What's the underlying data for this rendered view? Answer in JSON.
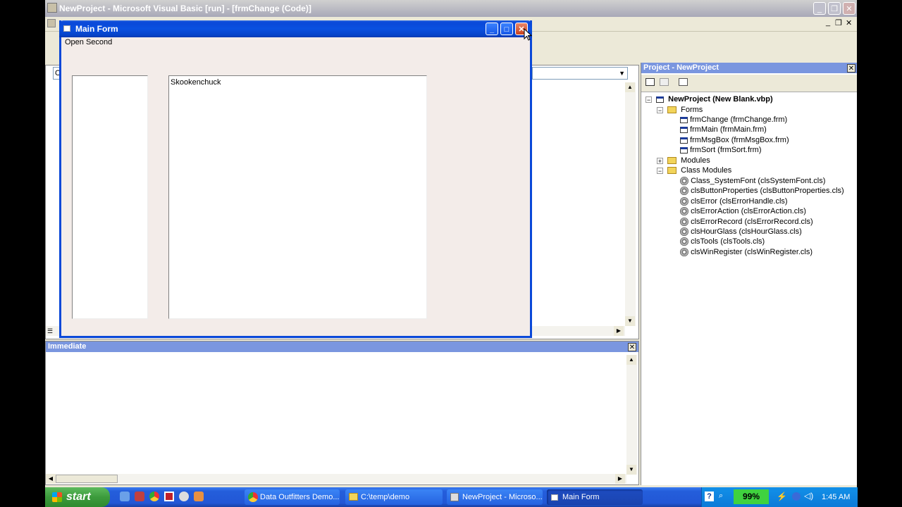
{
  "main_window": {
    "title": "NewProject - Microsoft Visual Basic [run] - [frmChange (Code)]"
  },
  "main_form": {
    "title": "Main Form",
    "menu": [
      "Open Second"
    ],
    "listbox_right_item": "Skookenchuck"
  },
  "code_pane": {
    "dropdown_left": "O"
  },
  "project_panel": {
    "title": "Project - NewProject",
    "root": "NewProject (New Blank.vbp)",
    "folders": {
      "forms": "Forms",
      "modules": "Modules",
      "class_modules": "Class Modules"
    },
    "forms": [
      "frmChange (frmChange.frm)",
      "frmMain (frmMain.frm)",
      "frmMsgBox (frmMsgBox.frm)",
      "frmSort (frmSort.frm)"
    ],
    "class_modules": [
      "Class_SystemFont (clsSystemFont.cls)",
      "clsButtonProperties (clsButtonProperties.cls)",
      "clsError (clsErrorHandle.cls)",
      "clsErrorAction (clsErrorAction.cls)",
      "clsErrorRecord (clsErrorRecord.cls)",
      "clsHourGlass (clsHourGlass.cls)",
      "clsTools (clsTools.cls)",
      "clsWinRegister (clsWinRegister.cls)"
    ]
  },
  "immediate_panel": {
    "title": "Immediate"
  },
  "taskbar": {
    "start_label": "start",
    "items": [
      "Data Outfitters Demo...",
      "C:\\temp\\demo",
      "NewProject - Microso...",
      "Main Form"
    ],
    "battery": "99%",
    "clock": "1:45 AM"
  },
  "colors": {
    "xp_blue": "#0a48d8",
    "form_bg": "#f3ece9",
    "ide_bg": "#ece9d8",
    "panel_header": "#7a96df",
    "taskbar": "#245edb",
    "start_green": "#3c9b3c"
  }
}
